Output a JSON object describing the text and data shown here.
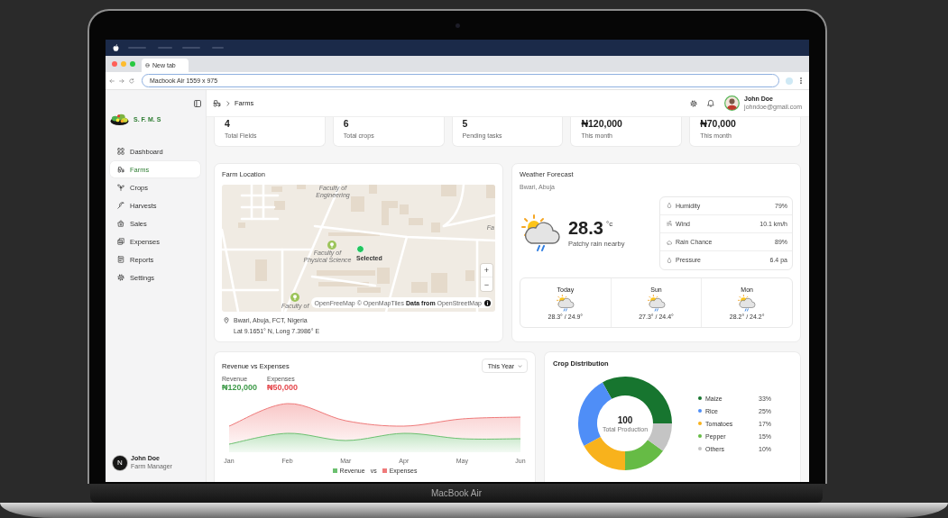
{
  "device": {
    "label": "MacBook Air"
  },
  "browser": {
    "tab_title": "New tab",
    "address": "Macbook Air 1559 x 975"
  },
  "sidebar": {
    "brand": "S. F. M. S",
    "items": [
      {
        "label": "Dashboard",
        "selected": false
      },
      {
        "label": "Farms",
        "selected": true
      },
      {
        "label": "Crops",
        "selected": false
      },
      {
        "label": "Harvests",
        "selected": false
      },
      {
        "label": "Sales",
        "selected": false
      },
      {
        "label": "Expenses",
        "selected": false
      },
      {
        "label": "Reports",
        "selected": false
      },
      {
        "label": "Settings",
        "selected": false
      }
    ],
    "user": {
      "initial": "N",
      "name": "John Doe",
      "role": "Farm Manager"
    }
  },
  "header": {
    "breadcrumb": "Farms",
    "user": {
      "name": "John Doe",
      "email": "johndoe@gmail.com"
    }
  },
  "stats": [
    {
      "value": "4",
      "label": "Total Fields"
    },
    {
      "value": "6",
      "label": "Total crops"
    },
    {
      "value": "5",
      "label": "Pending tasks"
    },
    {
      "value": "₦120,000",
      "label": "This month"
    },
    {
      "value": "₦70,000",
      "label": "This month"
    }
  ],
  "farm_location": {
    "title": "Farm Location",
    "map": {
      "labels": [
        "Faculty of Engineering",
        "Faculty of Physical Science",
        "Faculty of",
        "Fa"
      ],
      "marker_label": "Selected",
      "zoom_controls": [
        "+",
        "−"
      ],
      "attribution": "OpenFreeMap © OpenMapTiles **Data from** OpenStreetMap"
    },
    "address": "Bwari, Abuja, FCT, Nigeria",
    "coordinates": "Lat 9.1651° N, Long 7.3986° E"
  },
  "weather": {
    "title": "Weather Forecast",
    "location": "Bwari, Abuja",
    "temperature": "28.3",
    "unit": "°c",
    "condition": "Patchy rain nearby",
    "details": [
      {
        "label": "Humidity",
        "value": "79%"
      },
      {
        "label": "Wind",
        "value": "10.1 km/h"
      },
      {
        "label": "Rain Chance",
        "value": "89%"
      },
      {
        "label": "Pressure",
        "value": "6.4 pa"
      }
    ],
    "forecast": [
      {
        "day": "Today",
        "range": "28.3° / 24.9°"
      },
      {
        "day": "Sun",
        "range": "27.3° / 24.4°"
      },
      {
        "day": "Mon",
        "range": "28.2° / 24.2°"
      }
    ]
  },
  "revenue": {
    "title": "Revenue vs Expenses",
    "period": "This Year",
    "totals": [
      {
        "label": "Revenue",
        "value": "₦120,000",
        "color": "#3f9b4a"
      },
      {
        "label": "Expenses",
        "value": "₦50,000",
        "color": "#e5484d"
      }
    ],
    "x_labels": [
      "Jan",
      "Feb",
      "Mar",
      "Apr",
      "May",
      "Jun"
    ],
    "legend": [
      {
        "label": "Revenue",
        "color": "#6cc070"
      },
      {
        "label": "Expenses",
        "color": "#ef7a7a"
      }
    ],
    "legend_joiner": "vs"
  },
  "crop_distribution": {
    "title": "Crop Distribution",
    "center_value": "100",
    "center_label": "Total Production",
    "chart_data": {
      "type": "donut",
      "categories": [
        "Maize",
        "Rice",
        "Tomatoes",
        "Pepper",
        "Others"
      ],
      "values": [
        33,
        25,
        17,
        15,
        10
      ],
      "colors": [
        "#17752f",
        "#4f8ef7",
        "#f8b21c",
        "#66bb45",
        "#c4c4c4"
      ],
      "value_labels": [
        "33%",
        "25%",
        "17%",
        "15%",
        "10%"
      ]
    }
  }
}
